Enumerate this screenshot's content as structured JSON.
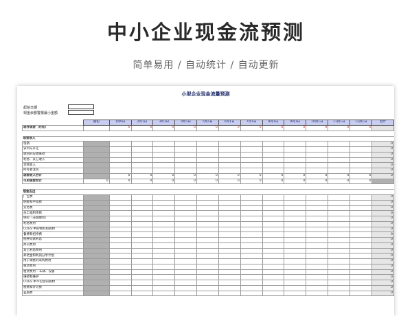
{
  "promo": {
    "title": "中小企业现金流预测",
    "subtitle": "简单易用 / 自动统计 / 自动更新"
  },
  "sheet": {
    "title": "小型企业现金流量预测",
    "meta": [
      {
        "label": "起始日期"
      },
      {
        "label": "现金余额警报最小金额"
      }
    ],
    "columns": [
      "期初",
      "1月0日",
      "2月1日",
      "3月1日",
      "4月1日",
      "5月1日",
      "6月1日",
      "7月1日",
      "8月1日",
      "9月1日",
      "10月1日",
      "11月1日",
      "12月1日",
      "合计"
    ],
    "opening_row": {
      "label": "现存现金（月初）",
      "values": [
        "0",
        "0",
        "0",
        "0",
        "0",
        "0",
        "0",
        "0",
        "0",
        "0",
        "0",
        "0"
      ]
    },
    "income_section": "现金收入",
    "income_items": [
      "现销",
      "该列与开让",
      "收回的应收账款",
      "利息、其它收入",
      "贷款收入",
      "所有者注资"
    ],
    "income_total": {
      "label": "现金收入合计",
      "values": [
        "0",
        "0",
        "0",
        "0",
        "0",
        "0",
        "0",
        "0",
        "0",
        "0",
        "0",
        "0"
      ]
    },
    "available_total": {
      "label": "可用现金合计",
      "values": [
        "0",
        "0",
        "0",
        "0",
        "0",
        "0",
        "0",
        "0",
        "0",
        "0",
        "0",
        "0",
        "0"
      ]
    },
    "expense_section": "现金支出",
    "expense_items": [
      "广告费",
      "佣金和手续费",
      "劳务费",
      "员工福利项目",
      "保险（非健康险）",
      "利息费用",
      "COGS 中的物料和耗材",
      "餐费和招待费",
      "抵押贷款利息",
      "办公费用",
      "其它利息费用",
      "养老金和利润分享计划",
      "用于销售的采购费用",
      "租赁费用",
      "租赁费用 – 车辆、设备",
      "维修和维护",
      "COGS 中不包含的耗材",
      "税费和许可费",
      "差旅费"
    ],
    "zero": "0"
  }
}
